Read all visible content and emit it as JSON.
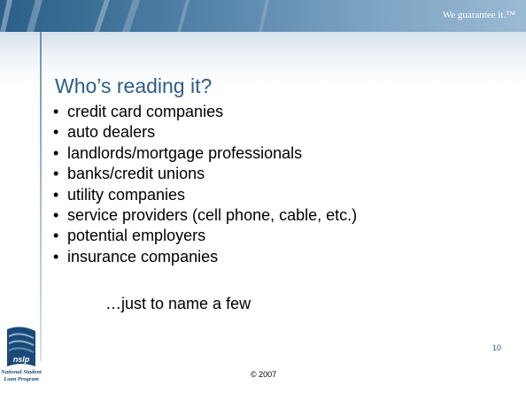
{
  "header": {
    "tagline": "We guarantee it.™"
  },
  "slide": {
    "title": "Who’s reading it?",
    "bullets": [
      "credit card companies",
      "auto dealers",
      "landlords/mortgage professionals",
      "banks/credit unions",
      "utility companies",
      "service providers (cell phone, cable, etc.)",
      "potential employers",
      "insurance companies"
    ],
    "bullet_glyph": "•",
    "closing": "…just to name a few"
  },
  "footer": {
    "page_number": "10",
    "copyright": "© 2007"
  },
  "logo": {
    "mark_text": "nslp",
    "name_line1": "National Student",
    "name_line2": "Loan Program"
  },
  "colors": {
    "title": "#2b5d8b",
    "band": "#4f7fa5",
    "logo": "#1b4a78"
  }
}
